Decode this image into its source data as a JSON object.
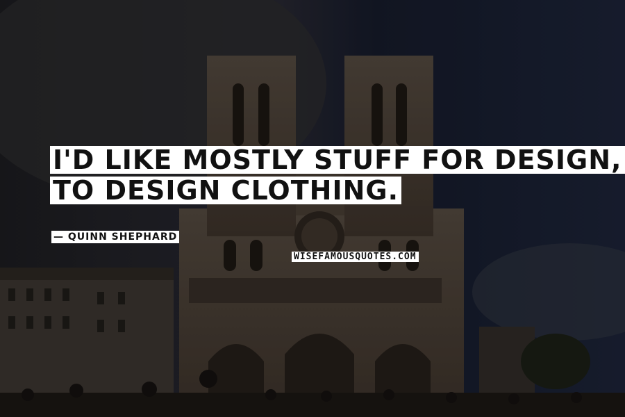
{
  "quote": {
    "line1": "I'D LIKE MOSTLY STUFF FOR DESIGN, BECAUSE I LIKE",
    "line2": "TO DESIGN CLOTHING."
  },
  "author": {
    "label": "QUINN SHEPHARD"
  },
  "watermark": {
    "label": "WISEFAMOUSQUOTES.COM"
  },
  "colors": {
    "sky": "#1b2233",
    "cathedral": "#4a4036",
    "text_box": "#ffffff",
    "text": "#111111"
  }
}
